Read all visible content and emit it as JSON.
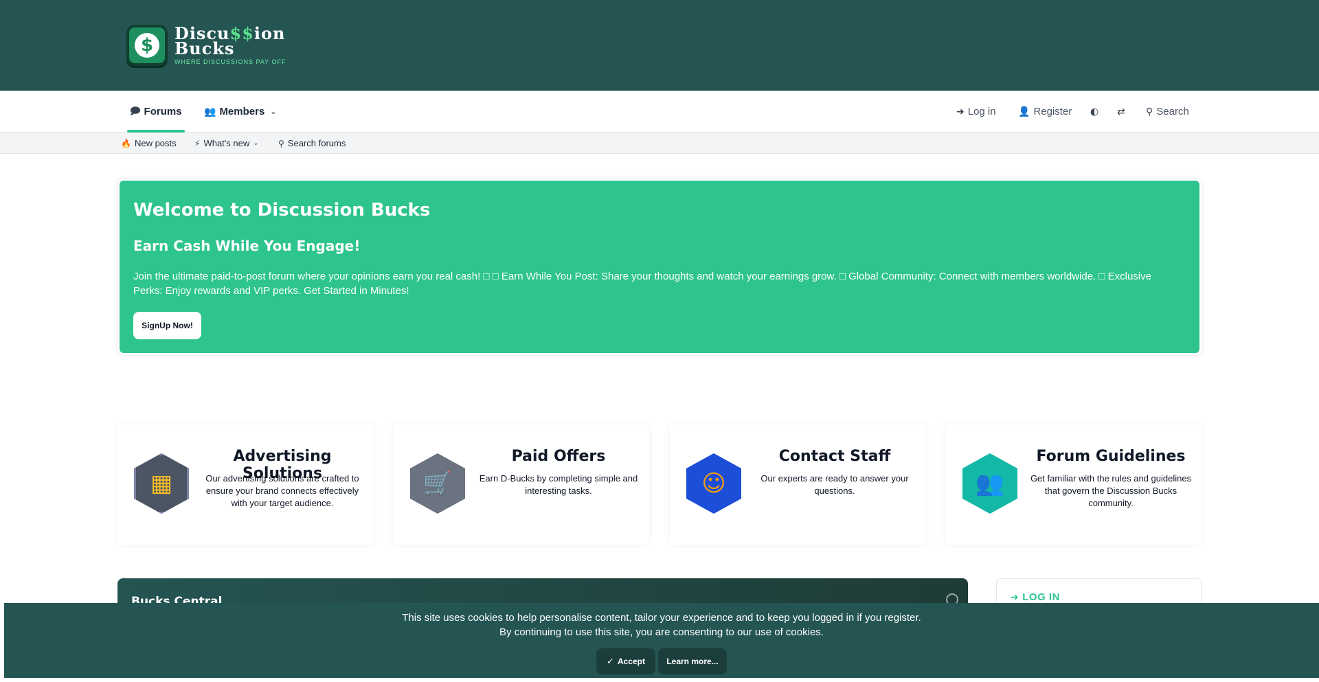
{
  "header": {
    "logo_line1": "Discu",
    "logo_dollar": "$$",
    "logo_line1_end": "ion",
    "logo_line2": "Bucks",
    "logo_tagline": "WHERE DISCUSSIONS PAY OFF",
    "logo_symbol": "$"
  },
  "nav": {
    "forums": "Forums",
    "members": "Members",
    "login": "Log in",
    "register": "Register",
    "search": "Search"
  },
  "subnav": {
    "new_posts": "New posts",
    "whats_new": "What's new",
    "search_forums": "Search forums"
  },
  "hero": {
    "title": "Welcome to Discussion Bucks",
    "subtitle": "Earn Cash While You Engage!",
    "body": "Join the ultimate paid-to-post forum where your opinions earn you real cash! □ □ Earn While You Post: Share your thoughts and watch your earnings grow. □ Global Community: Connect with members worldwide. □ Exclusive Perks: Enjoy rewards and VIP perks. Get Started in Minutes!",
    "signup": "SignUp Now!"
  },
  "cards": [
    {
      "title": "Advertising Solutions",
      "desc": "Our advertising solutions are crafted to ensure your brand connects effectively with your target audience."
    },
    {
      "title": "Paid Offers",
      "desc": "Earn D-Bucks by completing simple and interesting tasks."
    },
    {
      "title": "Contact Staff",
      "desc": "Our experts are ready to answer your questions."
    },
    {
      "title": "Forum Guidelines",
      "desc": "Get familiar with the rules and guidelines that govern the Discussion Bucks community."
    }
  ],
  "sections": {
    "bucks_central": "Bucks Central",
    "login_box": "LOG IN"
  },
  "cookie": {
    "line1": "This site uses cookies to help personalise content, tailor your experience and to keep you logged in if you register.",
    "line2": "By continuing to use this site, you are consenting to our use of cookies.",
    "accept": "Accept",
    "learn_more": "Learn more..."
  },
  "colors": {
    "header_bg": "#245553",
    "accent": "#2ec48e",
    "cookie_bg": "#245553"
  }
}
